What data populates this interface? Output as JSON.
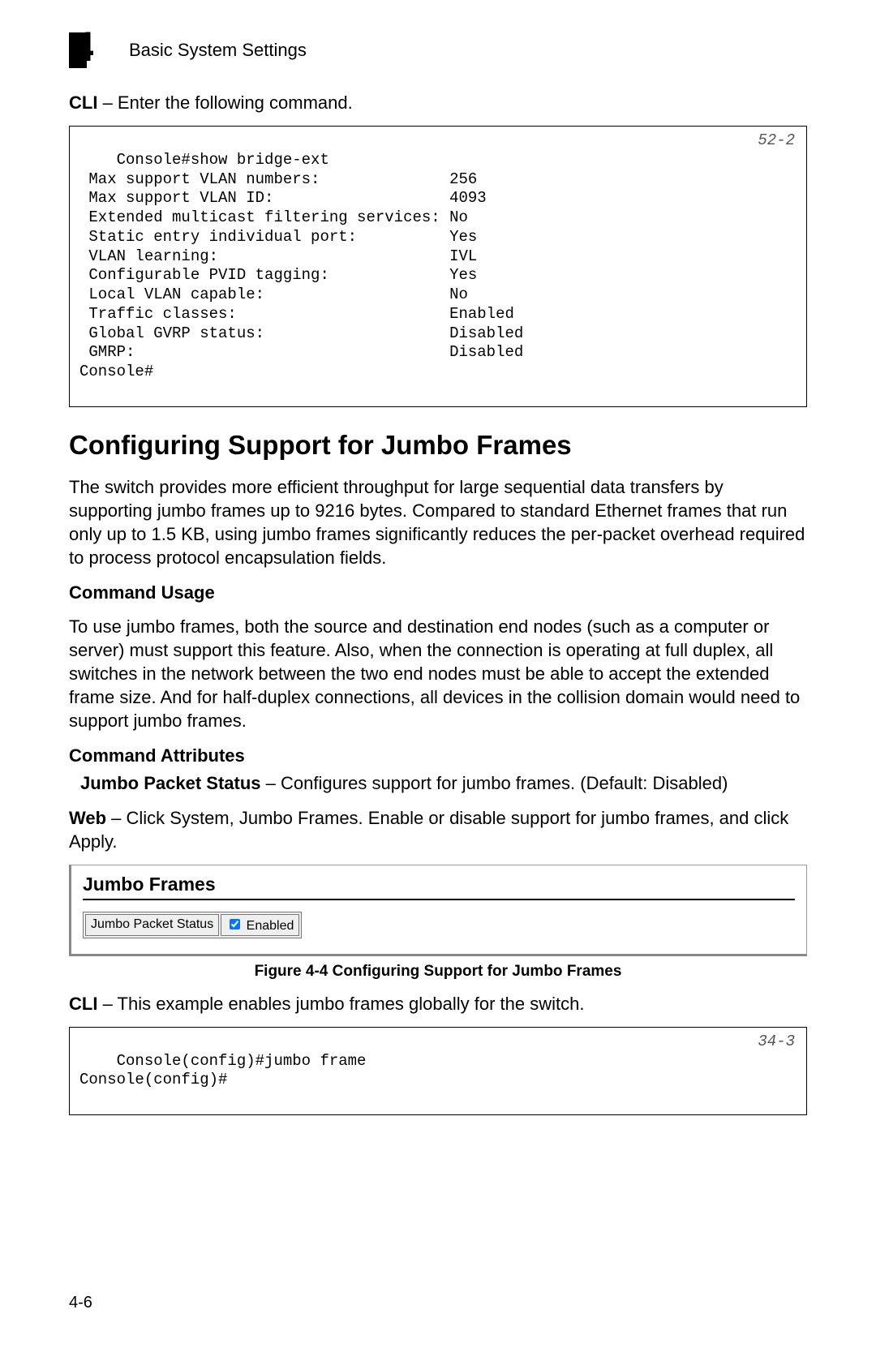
{
  "header": {
    "chapter_number": "4",
    "running_title": "Basic System Settings"
  },
  "intro_cli": {
    "lead_bold": "CLI",
    "lead_rest": " – Enter the following command."
  },
  "cli_block_1": {
    "ref": "52-2",
    "text": "Console#show bridge-ext\n Max support VLAN numbers:              256\n Max support VLAN ID:                   4093\n Extended multicast filtering services: No\n Static entry individual port:          Yes\n VLAN learning:                         IVL\n Configurable PVID tagging:             Yes\n Local VLAN capable:                    No\n Traffic classes:                       Enabled\n Global GVRP status:                    Disabled\n GMRP:                                  Disabled\nConsole#"
  },
  "section": {
    "title": "Configuring Support for Jumbo Frames",
    "para_1": "The switch provides more efficient throughput for large sequential data transfers by supporting jumbo frames up to 9216 bytes. Compared to standard Ethernet frames that run only up to 1.5 KB, using jumbo frames significantly reduces the per-packet overhead required to process protocol encapsulation fields.",
    "usage_head": "Command Usage",
    "usage_para": "To use jumbo frames, both the source and destination end nodes (such as a computer or server) must support this feature. Also, when the connection is operating at full duplex, all switches in the network between the two end nodes must be able to accept the extended frame size. And for half-duplex connections, all devices in the collision domain would need to support jumbo frames.",
    "attr_head": "Command Attributes",
    "attr_bold": "Jumbo Packet Status",
    "attr_rest": " – Configures support for jumbo frames. (Default: Disabled)",
    "web_bold": "Web",
    "web_rest": " – Click System, Jumbo Frames. Enable or disable support for jumbo frames, and click Apply."
  },
  "figure": {
    "panel_title": "Jumbo Frames",
    "row_label": "Jumbo Packet Status",
    "checkbox_label": "Enabled",
    "checkbox_checked": true,
    "caption": "Figure 4-4  Configuring Support for Jumbo Frames"
  },
  "cli2_lead": {
    "bold": "CLI",
    "rest": " – This example enables jumbo frames globally for the switch."
  },
  "cli_block_2": {
    "ref": "34-3",
    "text": "Console(config)#jumbo frame\nConsole(config)#"
  },
  "page_number": "4-6"
}
